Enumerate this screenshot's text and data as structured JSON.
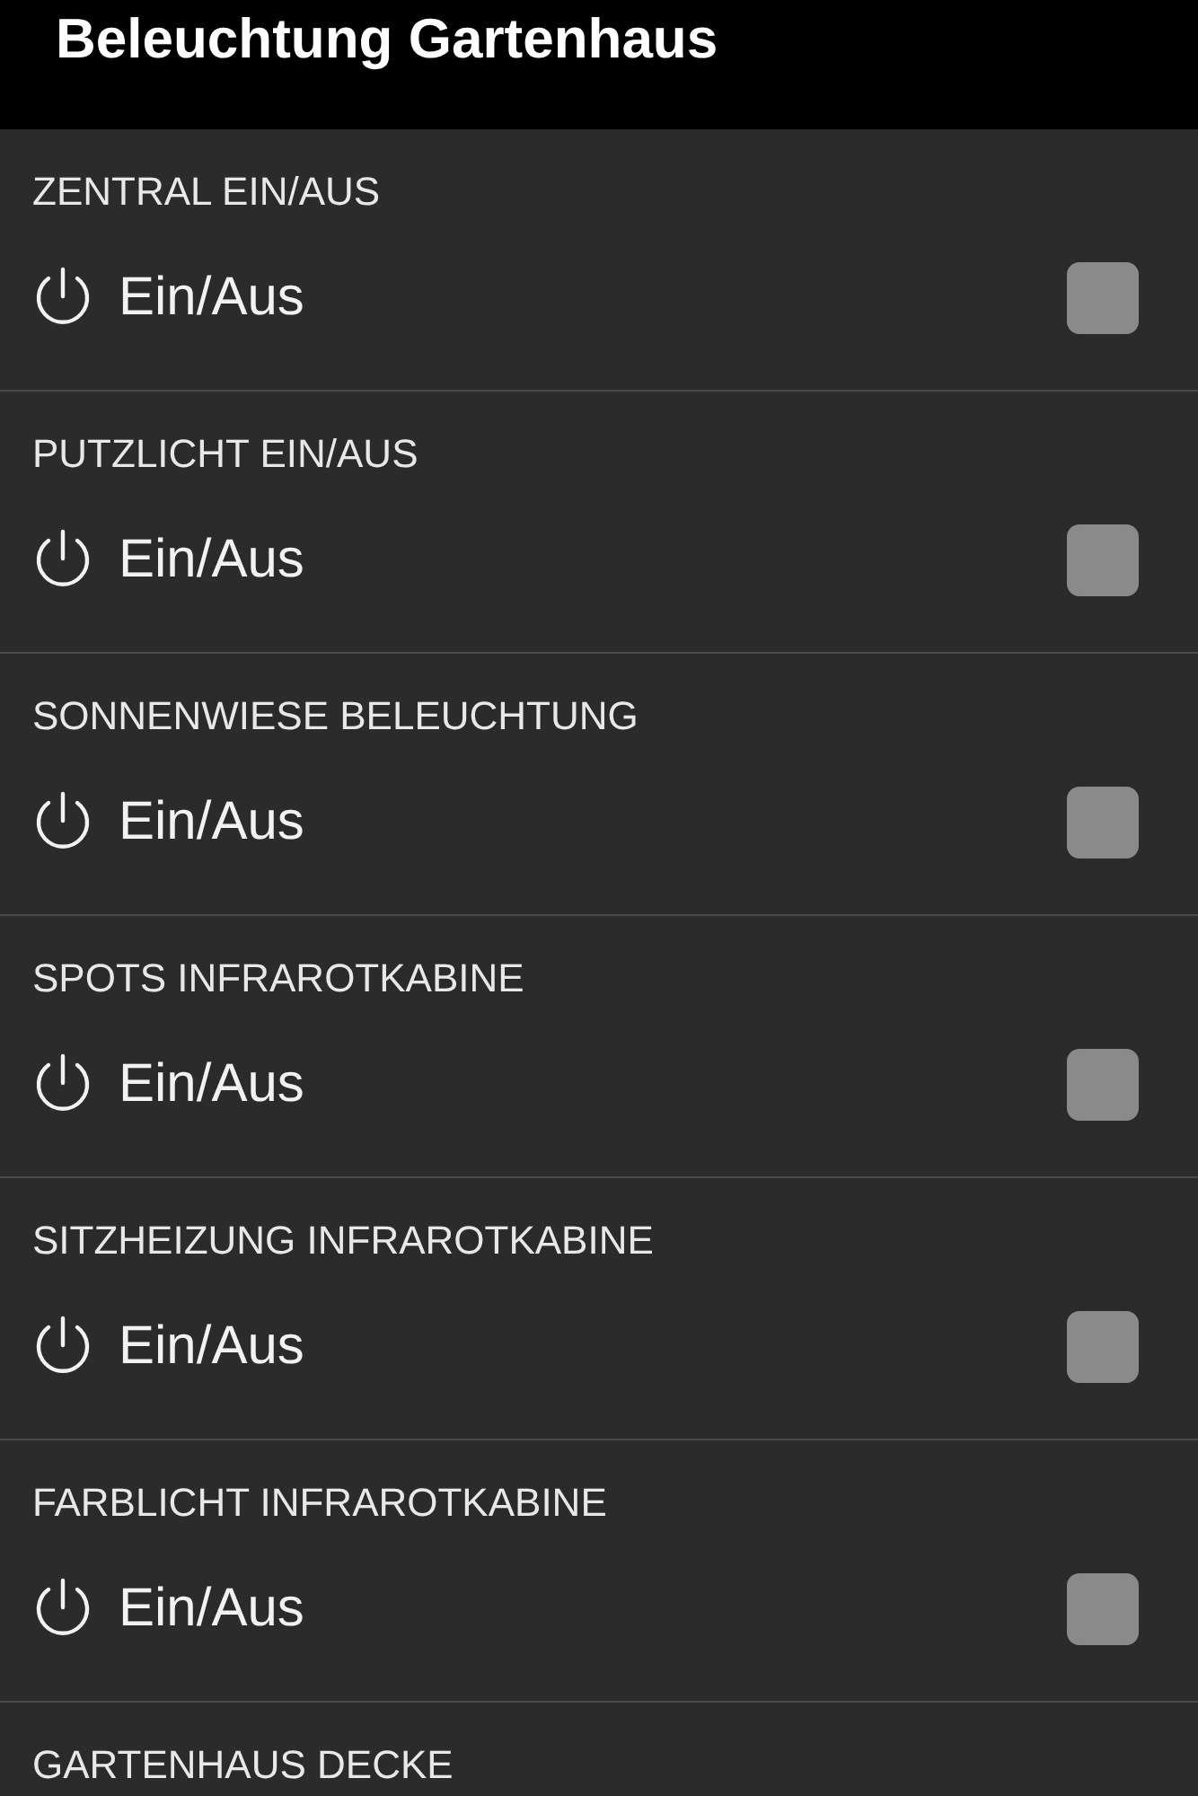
{
  "header": {
    "title": "Beleuchtung Gartenhaus"
  },
  "sections": [
    {
      "label": "ZENTRAL EIN/AUS",
      "toggle": {
        "label": "Ein/Aus",
        "checked": false
      }
    },
    {
      "label": "PUTZLICHT EIN/AUS",
      "toggle": {
        "label": "Ein/Aus",
        "checked": false
      }
    },
    {
      "label": "SONNENWIESE BELEUCHTUNG",
      "toggle": {
        "label": "Ein/Aus",
        "checked": false
      }
    },
    {
      "label": "SPOTS INFRAROTKABINE",
      "toggle": {
        "label": "Ein/Aus",
        "checked": false
      }
    },
    {
      "label": "SITZHEIZUNG INFRAROTKABINE",
      "toggle": {
        "label": "Ein/Aus",
        "checked": false
      }
    },
    {
      "label": "FARBLICHT INFRAROTKABINE",
      "toggle": {
        "label": "Ein/Aus",
        "checked": false
      }
    },
    {
      "label": "GARTENHAUS DECKE"
    }
  ]
}
